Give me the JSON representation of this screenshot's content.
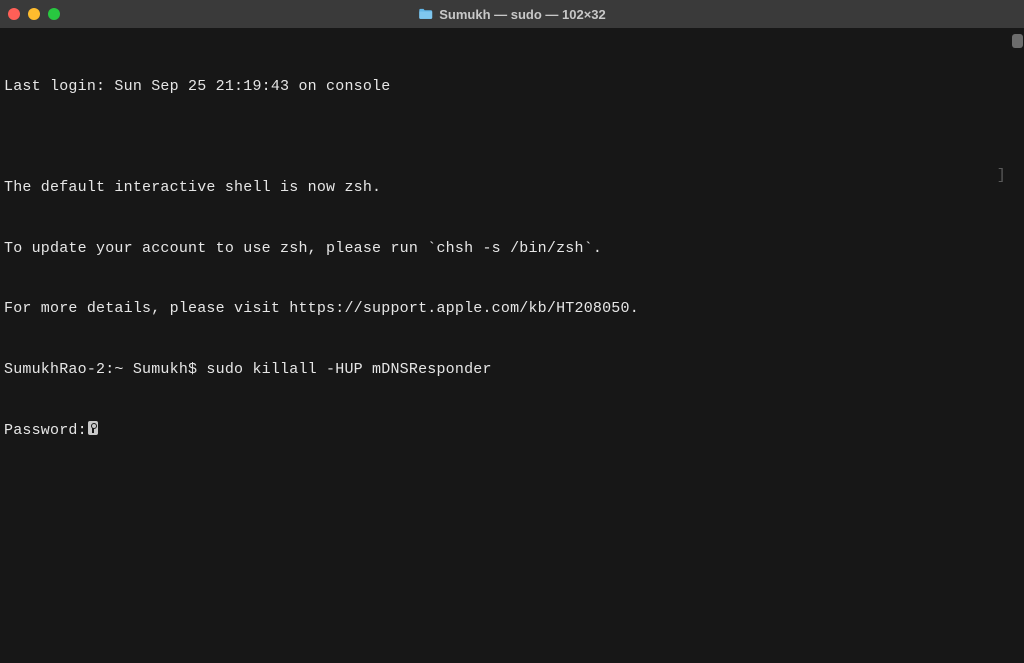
{
  "titlebar": {
    "title": "Sumukh — sudo — 102×32"
  },
  "terminal": {
    "lines": {
      "last_login": "Last login: Sun Sep 25 21:19:43 on console",
      "blank1": "",
      "zsh_notice1": "The default interactive shell is now zsh.",
      "zsh_notice2": "To update your account to use zsh, please run `chsh -s /bin/zsh`.",
      "zsh_notice3": "For more details, please visit https://support.apple.com/kb/HT208050.",
      "prompt_line": "SumukhRao-2:~ Sumukh$ sudo killall -HUP mDNSResponder",
      "password_label": "Password:"
    },
    "right_bracket": "]",
    "prompt": {
      "host": "SumukhRao-2",
      "path": "~",
      "user": "Sumukh",
      "symbol": "$",
      "command": "sudo killall -HUP mDNSResponder"
    }
  }
}
